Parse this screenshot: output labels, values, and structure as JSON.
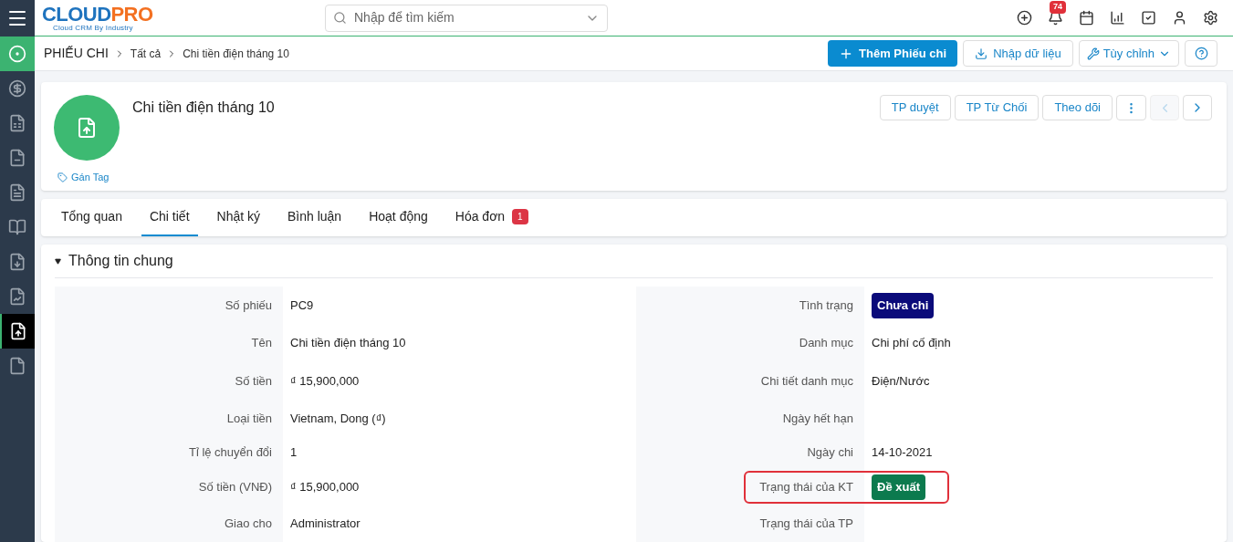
{
  "logo": {
    "first": "CLOUD",
    "second": "PRO",
    "tagline": "Cloud CRM By Industry"
  },
  "search": {
    "placeholder": "Nhập để tìm kiếm"
  },
  "notifications": {
    "count": "74"
  },
  "sidebar": {
    "items": [
      {
        "selected": false
      },
      {
        "selected": false
      },
      {
        "selected": false
      },
      {
        "selected": false
      },
      {
        "selected": false
      },
      {
        "selected": false
      },
      {
        "selected": false
      },
      {
        "selected": true
      },
      {
        "selected": false
      }
    ]
  },
  "breadcrumb": {
    "module": "PHIẾU CHI",
    "items": [
      "Tất cả",
      "Chi tiền điện tháng 10"
    ]
  },
  "actions": {
    "primary": "Thêm Phiếu chi",
    "import": "Nhập dữ liệu",
    "customize": "Tùy chỉnh"
  },
  "record": {
    "title": "Chi tiền điện tháng 10",
    "tag_link": "Gán Tag",
    "buttons": [
      "TP duyệt",
      "TP Từ Chối",
      "Theo dõi"
    ],
    "prev_disabled": true
  },
  "tabs": [
    {
      "label": "Tổng quan",
      "selected": false
    },
    {
      "label": "Chi tiết",
      "selected": true
    },
    {
      "label": "Nhật ký",
      "selected": false
    },
    {
      "label": "Bình luận",
      "selected": false
    },
    {
      "label": "Hoạt động",
      "selected": false
    },
    {
      "label": "Hóa đơn",
      "selected": false,
      "badge": "1"
    }
  ],
  "section": {
    "title": "Thông tin chung",
    "expanded": true,
    "rows": [
      [
        {
          "label": "Số phiếu",
          "kind": "text",
          "value": "PC9"
        },
        {
          "label": "Tình trạng",
          "kind": "badge",
          "value": "Chưa chi",
          "color": "#0b0b7a"
        }
      ],
      [
        {
          "label": "Tên",
          "kind": "text",
          "value": "Chi tiền điện tháng 10"
        },
        {
          "label": "Danh mục",
          "kind": "text",
          "value": "Chi phí cố định"
        }
      ],
      [
        {
          "label": "Số tiền",
          "kind": "text",
          "value": "₫ 15,900,000"
        },
        {
          "label": "Chi tiết danh mục",
          "kind": "text",
          "value": "Điện/Nước"
        }
      ],
      [
        {
          "label": "Loại tiền",
          "kind": "text",
          "value": "Vietnam, Dong (₫)"
        },
        {
          "label": "Ngày hết hạn",
          "kind": "text"
        }
      ],
      [
        {
          "label": "Tỉ lệ chuyển đổi",
          "kind": "text",
          "value": "1"
        },
        {
          "label": "Ngày chi",
          "kind": "text",
          "value": "14-10-2021"
        }
      ],
      [
        {
          "label": "Số tiền (VNĐ)",
          "kind": "text",
          "value": "₫ 15,900,000"
        },
        {
          "label": "Trạng thái của KT",
          "kind": "badge",
          "value": "Đề xuất",
          "color": "#0c7a4e",
          "highlighted": true
        }
      ],
      [
        {
          "label": "Giao cho",
          "kind": "text",
          "value": "Administrator"
        },
        {
          "label": "Trạng thái của TP",
          "kind": "text"
        }
      ]
    ]
  }
}
